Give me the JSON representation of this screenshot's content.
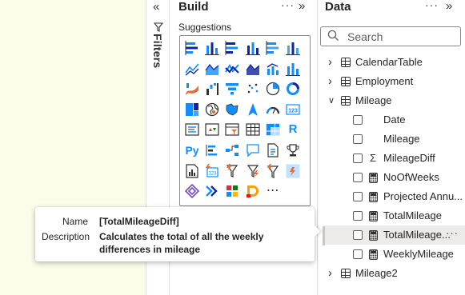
{
  "filters_pane": {
    "label": "Filters",
    "collapse_icon": "double-chevron-left-icon",
    "filter_icon": "funnel-icon"
  },
  "build_pane": {
    "title": "Build",
    "suggestions_label": "Suggestions",
    "visuals": [
      "stacked-bar-chart",
      "stacked-column-chart",
      "clustered-bar-chart",
      "clustered-column-chart",
      "100-percent-stacked-bar-chart",
      "100-percent-stacked-column-chart",
      "line-chart",
      "area-chart",
      "stacked-area-chart",
      "100-percent-stacked-area-chart",
      "line-and-stacked-column-chart",
      "line-and-clustered-column-chart",
      "ribbon-chart",
      "waterfall-chart",
      "funnel-chart",
      "scatter-chart",
      "pie-chart",
      "donut-chart",
      "treemap",
      "map",
      "filled-map",
      "azure-map",
      "gauge",
      "card",
      "multi-row-card",
      "kpi",
      "slicer",
      "table",
      "matrix",
      "r-visual",
      "python-visual",
      "key-influencers",
      "decomposition-tree",
      "qa-visual",
      "smart-narrative",
      "metrics",
      "paginated-report",
      "power-apps",
      "power-automate",
      "narrative-visual",
      "filter-visual",
      "analytics-visual",
      "power-apps-for-power-bi",
      "power-automate-flow",
      "app-source-visual",
      "dremio-visual",
      "more-visuals"
    ],
    "more_glyph": "⋯"
  },
  "data_pane": {
    "title": "Data",
    "search": {
      "placeholder": "Search"
    },
    "tables": [
      {
        "name": "CalendarTable",
        "expanded": false
      },
      {
        "name": "Employment",
        "expanded": false
      },
      {
        "name": "Mileage",
        "expanded": true,
        "fields": [
          {
            "name": "Date",
            "type": "column"
          },
          {
            "name": "Mileage",
            "type": "column"
          },
          {
            "name": "MileageDiff",
            "type": "sum-column"
          },
          {
            "name": "NoOfWeeks",
            "type": "measure"
          },
          {
            "name": "Projected Annu...",
            "type": "measure"
          },
          {
            "name": "TotalMileage",
            "type": "measure"
          },
          {
            "name": "TotalMileage...",
            "type": "measure",
            "selected": true
          },
          {
            "name": "WeeklyMileage",
            "type": "measure"
          }
        ]
      },
      {
        "name": "Mileage2",
        "expanded": false
      }
    ]
  },
  "tooltip": {
    "name_label": "Name",
    "name_value": "[TotalMileageDiff]",
    "description_label": "Description",
    "description_line1": "Calculates the total of all the weekly",
    "description_line2": "differences in mileage"
  },
  "colors": {
    "accent_blue": "#118dff",
    "dark_blue": "#12239e",
    "orange": "#e66c37",
    "purple": "#744ec2",
    "teal": "#41a4ff",
    "selected_row": "#edebe9"
  }
}
